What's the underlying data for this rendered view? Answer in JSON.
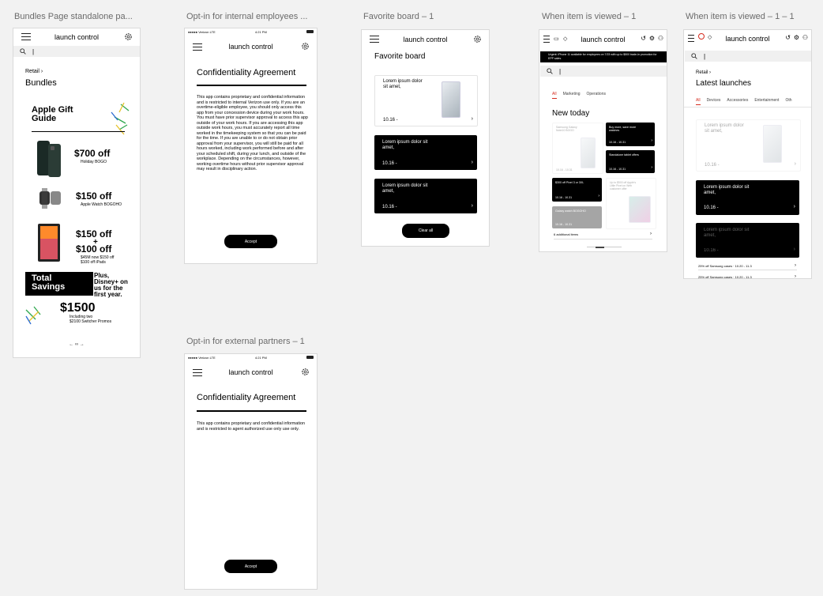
{
  "artboards": {
    "bundles": {
      "title": "Bundles Page standalone pa...",
      "header": "launch control",
      "breadcrumb": "Retail ›",
      "page_title": "Bundles",
      "gift_guide": "Apple Gift Guide",
      "offer1_price": "$700 off",
      "offer1_sub": "Holiday BOGO",
      "offer2_price": "$150 off",
      "offer2_sub": "Apple Watch BOGOHO",
      "offer3_price": "$150 off",
      "offer3_plus": "+",
      "offer3_price2": "$100 off",
      "offer3_sub": "$45M now $150 off",
      "offer3_sub2": "$100 off iPads",
      "total_savings": "Total Savings",
      "disney": "Plus, Disney+ on us for the first year.",
      "savings_amount": "$1500",
      "savings_sub": "Including two",
      "savings_sub2": "$2100 Switcher Promos",
      "pager": "← ∞ →"
    },
    "internal": {
      "title": "Opt-in for internal employees ...",
      "carrier": "●●●●● Verizon   LTE",
      "time": "4:21 PM",
      "header": "launch control",
      "heading": "Confidentiality Agreement",
      "body": "This app contains proprietary and confidential information and is restricted to internal Verizon use only.  If you are an overtime-eligible employee, you should only access this app from your concession device during your work hours. You must have prior supervisor approval to access this app outside of your work hours. If you are accessing this app outside work hours, you must accurately report all time worked in the timekeeping system so that you can be paid for the time. If you are unable to or do not obtain prior approval from your supervisor, you will still be paid for all hours worked, including work performed before and after your scheduled shift, during your lunch, and outside of the workplace.  Depending on the circumstances, however, working overtime hours without prior supervisor approval may result in disciplinary action.",
      "accept": "Accept"
    },
    "external": {
      "title": "Opt-in for external partners – 1",
      "carrier": "●●●●● Verizon   LTE",
      "time": "4:21 PM",
      "header": "launch control",
      "heading": "Confidentiality Agreement",
      "body": "This app contains proprietary and confidential information and is restricted to agent authorized use only use only.",
      "accept": "Accept"
    },
    "favorite": {
      "title": "Favorite board – 1",
      "header": "launch control",
      "heading": "Favorite board",
      "card1": "Lorem ipsum dolor sit amet,",
      "card1_date": "10.16 -",
      "card2": "Lorem ipsum dolor sit amet,",
      "card2_date": "10.16 -",
      "card3": "Lorem ipsum dolor sit amet,",
      "card3_date": "10.16 -",
      "clear": "Clear all"
    },
    "viewed": {
      "title": "When item is viewed – 1",
      "header": "launch control",
      "banner": "Urgent: iPhone 11 available for employees on 7/23 with up to $500 trade-in promotion for EPP sales.",
      "tabs": [
        "All",
        "Marketing",
        "Operations"
      ],
      "heading": "New today",
      "tile1": "Samsung Galaxy Note10 BOGO",
      "tile2": "Buy more, save more watches",
      "tile3": "Standalone tablet offers",
      "tile4": "$300 off Pixel 3 or 3XL",
      "tile5": "Up to $500 off Apple's Little Pixel on Web customer offer",
      "tile6": "Galaxy watch BOGOHO",
      "tile_date": "10.16 - 10.31",
      "additional": "6 additional items"
    },
    "viewed2": {
      "title": "When item is viewed – 1 – 1",
      "header": "launch control",
      "breadcrumb": "Retail ›",
      "heading": "Latest launches",
      "tabs": [
        "All",
        "Devices",
        "Accessories",
        "Entertainment",
        "Oth"
      ],
      "card1": "Lorem ipsum dolor sit amet,",
      "card1_date": "10.16 -",
      "card2": "Lorem ipsum dolor sit amet,",
      "card2_date": "10.16 -",
      "card3": "Lorem ipsum dolor sit amet,",
      "card3_date": "10.16 -",
      "row1": "25% off Samsung cases · 10.20 - 11.3",
      "row2": "25% off Samsung cases · 10.20 - 11.3"
    }
  }
}
